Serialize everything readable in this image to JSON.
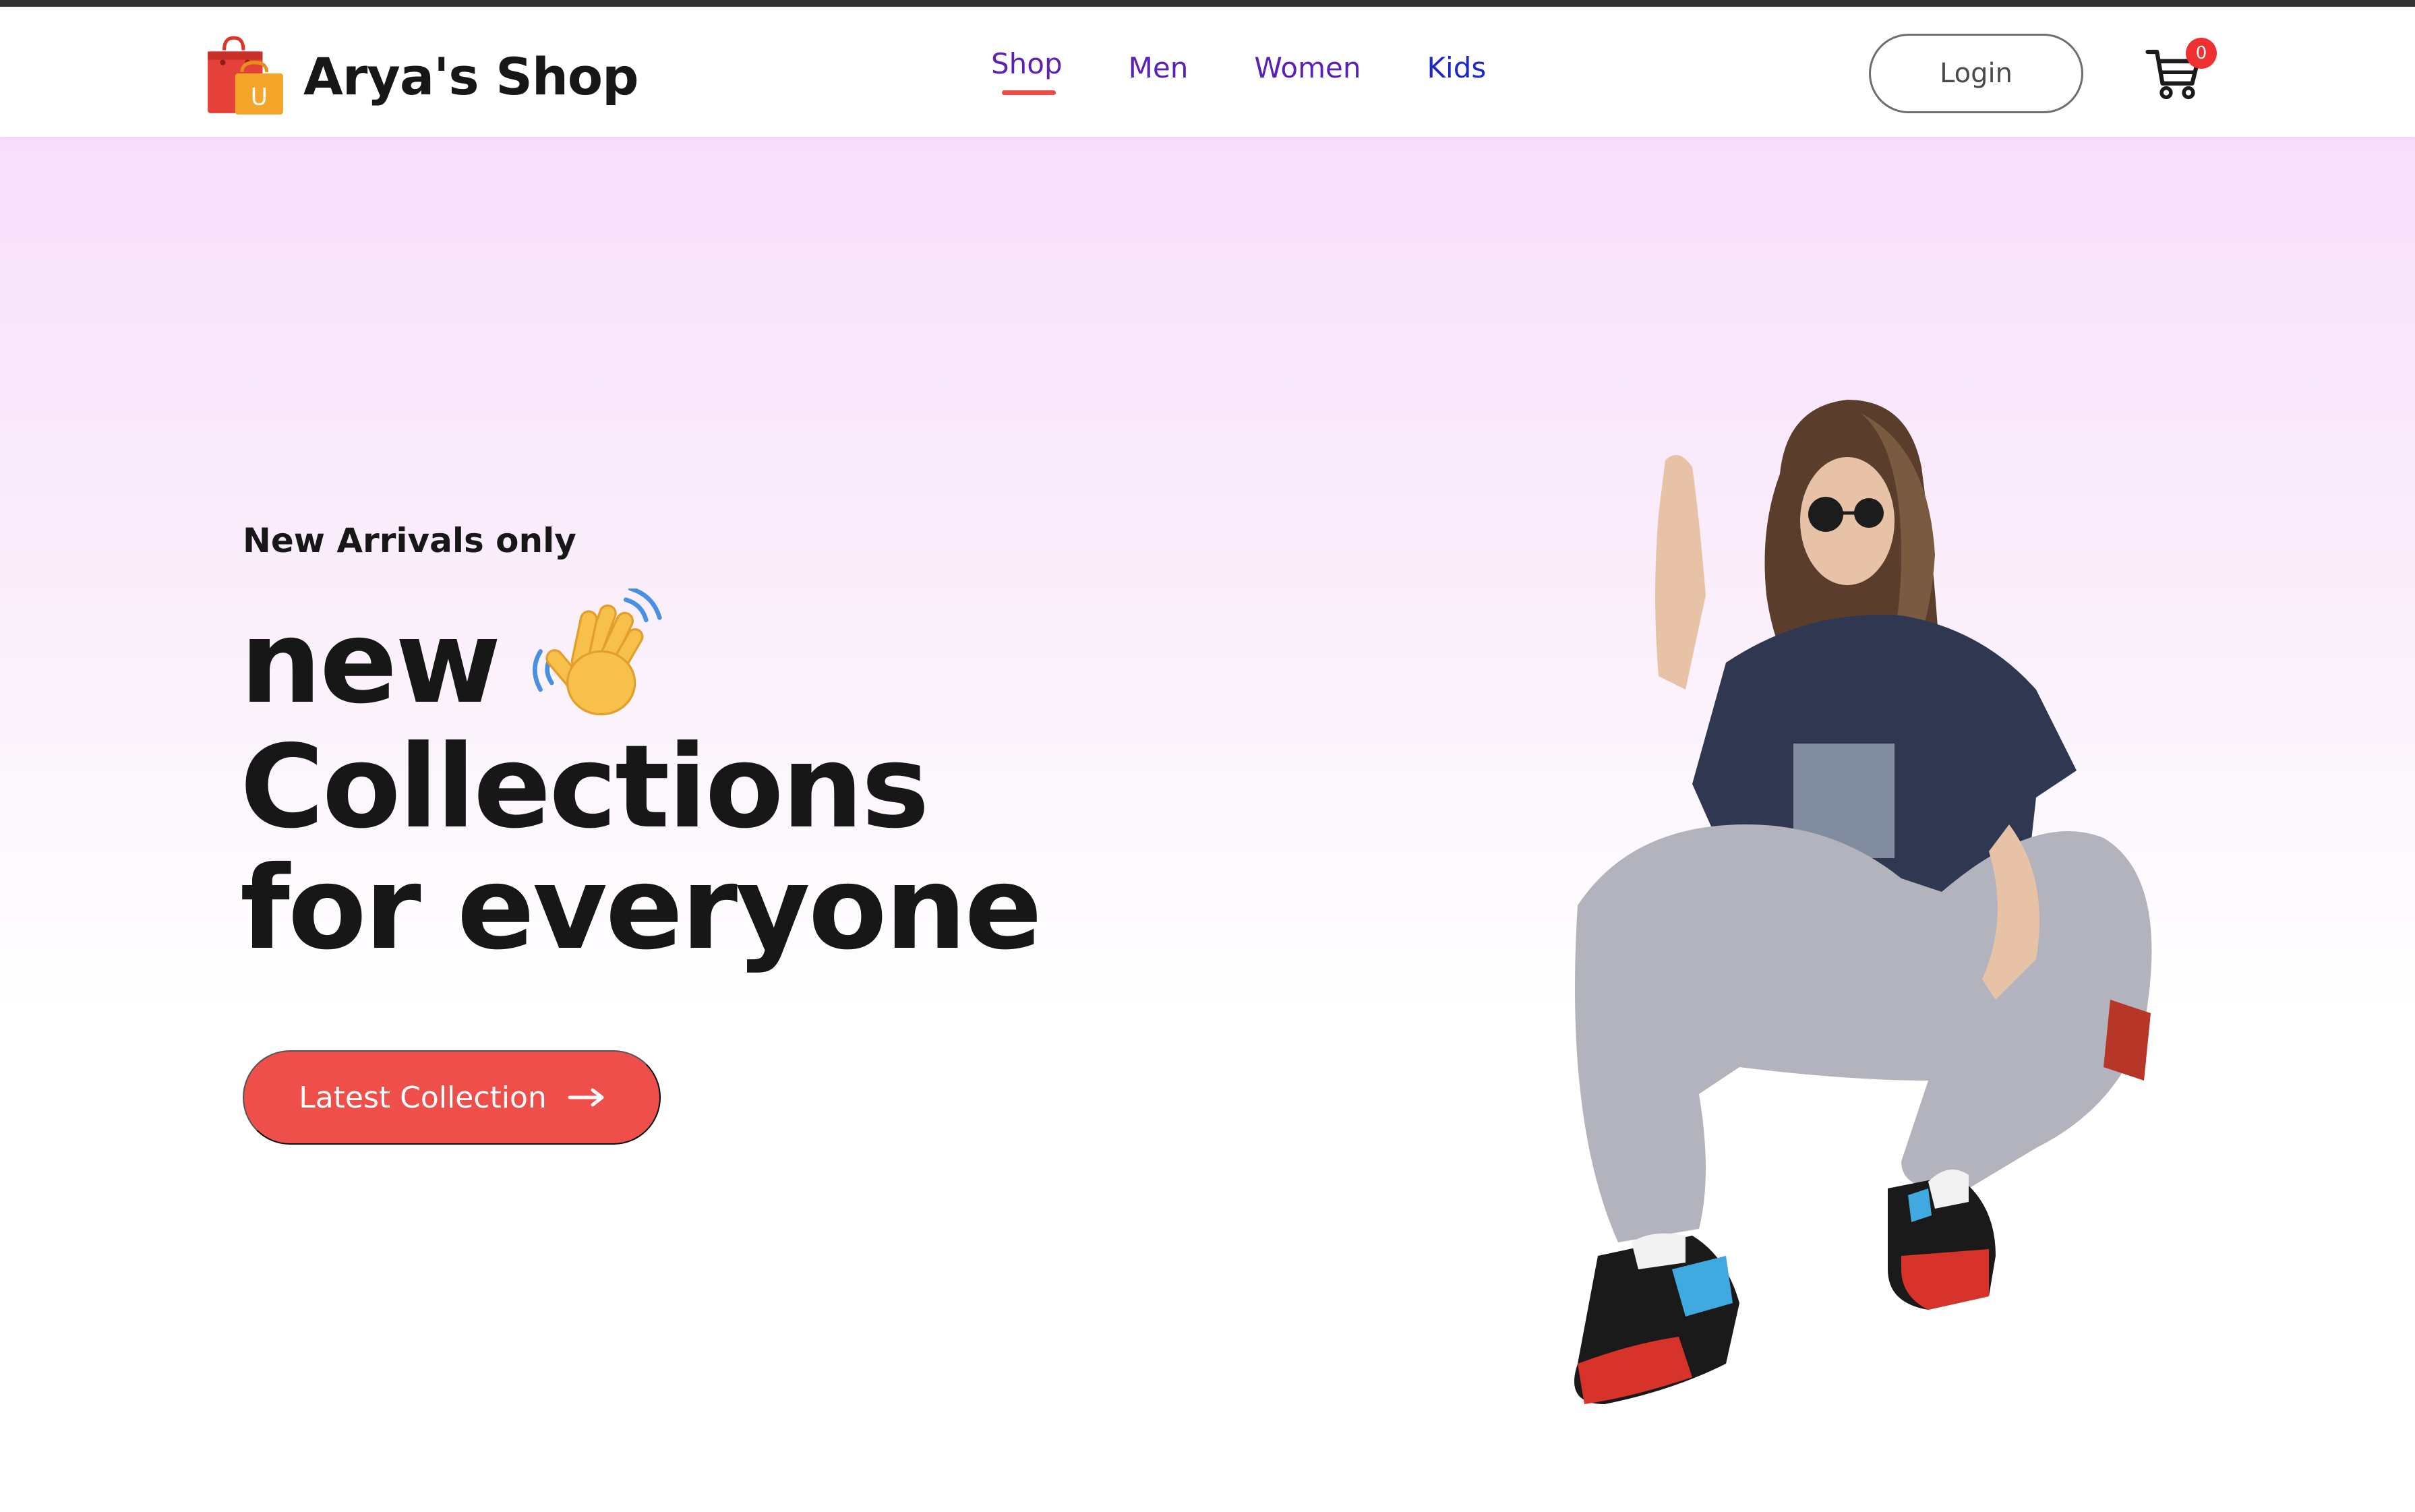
{
  "brand": {
    "name": "Arya's Shop",
    "logo_icon": "shopping-bags-icon",
    "logo_letter": "U"
  },
  "nav": {
    "items": [
      {
        "label": "Shop",
        "active": true
      },
      {
        "label": "Men",
        "active": false
      },
      {
        "label": "Women",
        "active": false
      },
      {
        "label": "Kids",
        "active": false
      }
    ],
    "active_underline_color": "#ef4c47"
  },
  "header": {
    "login_label": "Login",
    "cart_icon": "cart-icon",
    "cart_count": "0"
  },
  "hero": {
    "eyebrow": "New Arrivals only",
    "line1": "new",
    "line1_icon": "waving-hand-icon",
    "line2": "Collections",
    "line3": "for everyone",
    "cta_label": "Latest Collection",
    "cta_icon": "arrow-right-icon",
    "cta_color": "#ef4f4a",
    "image": "hero-model-image"
  },
  "colors": {
    "accent": "#ef4c47",
    "nav_purple": "#5b21b6",
    "nav_blue": "#1d27c9",
    "hero_gradient_top": "#f7dffb"
  }
}
